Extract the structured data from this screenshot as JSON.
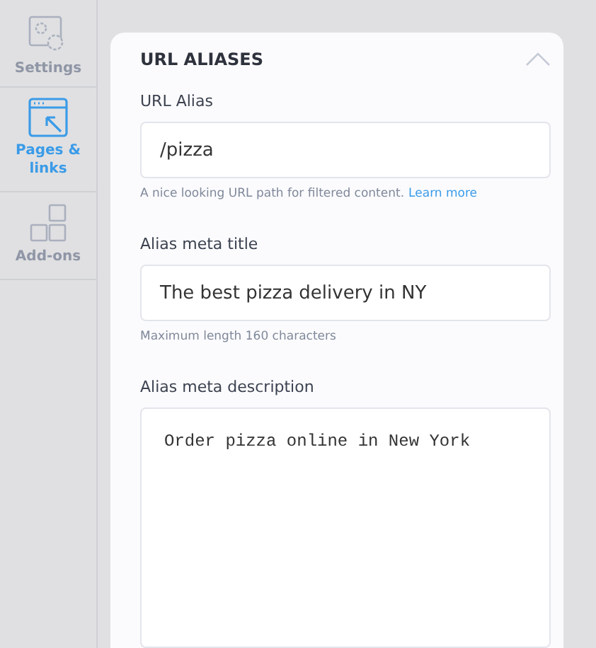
{
  "sidebar": {
    "items": [
      {
        "label": "Settings",
        "kind": "gears",
        "selected": false
      },
      {
        "label": "Pages & links",
        "kind": "window",
        "selected": true
      },
      {
        "label": "Add-ons",
        "kind": "blocks",
        "selected": false
      }
    ]
  },
  "panel": {
    "title": "URL ALIASES",
    "expanded": true,
    "fields": [
      {
        "kind": "input",
        "label": "URL Alias",
        "value": "/pizza",
        "help": "A nice looking URL path for filtered content.",
        "link": "Learn more"
      },
      {
        "kind": "input",
        "label": "Alias meta title",
        "value": "The best pizza delivery in NY",
        "help": "Maximum length 160 characters"
      },
      {
        "kind": "textarea",
        "label": "Alias meta description",
        "value": "Order pizza online in New York"
      }
    ]
  }
}
